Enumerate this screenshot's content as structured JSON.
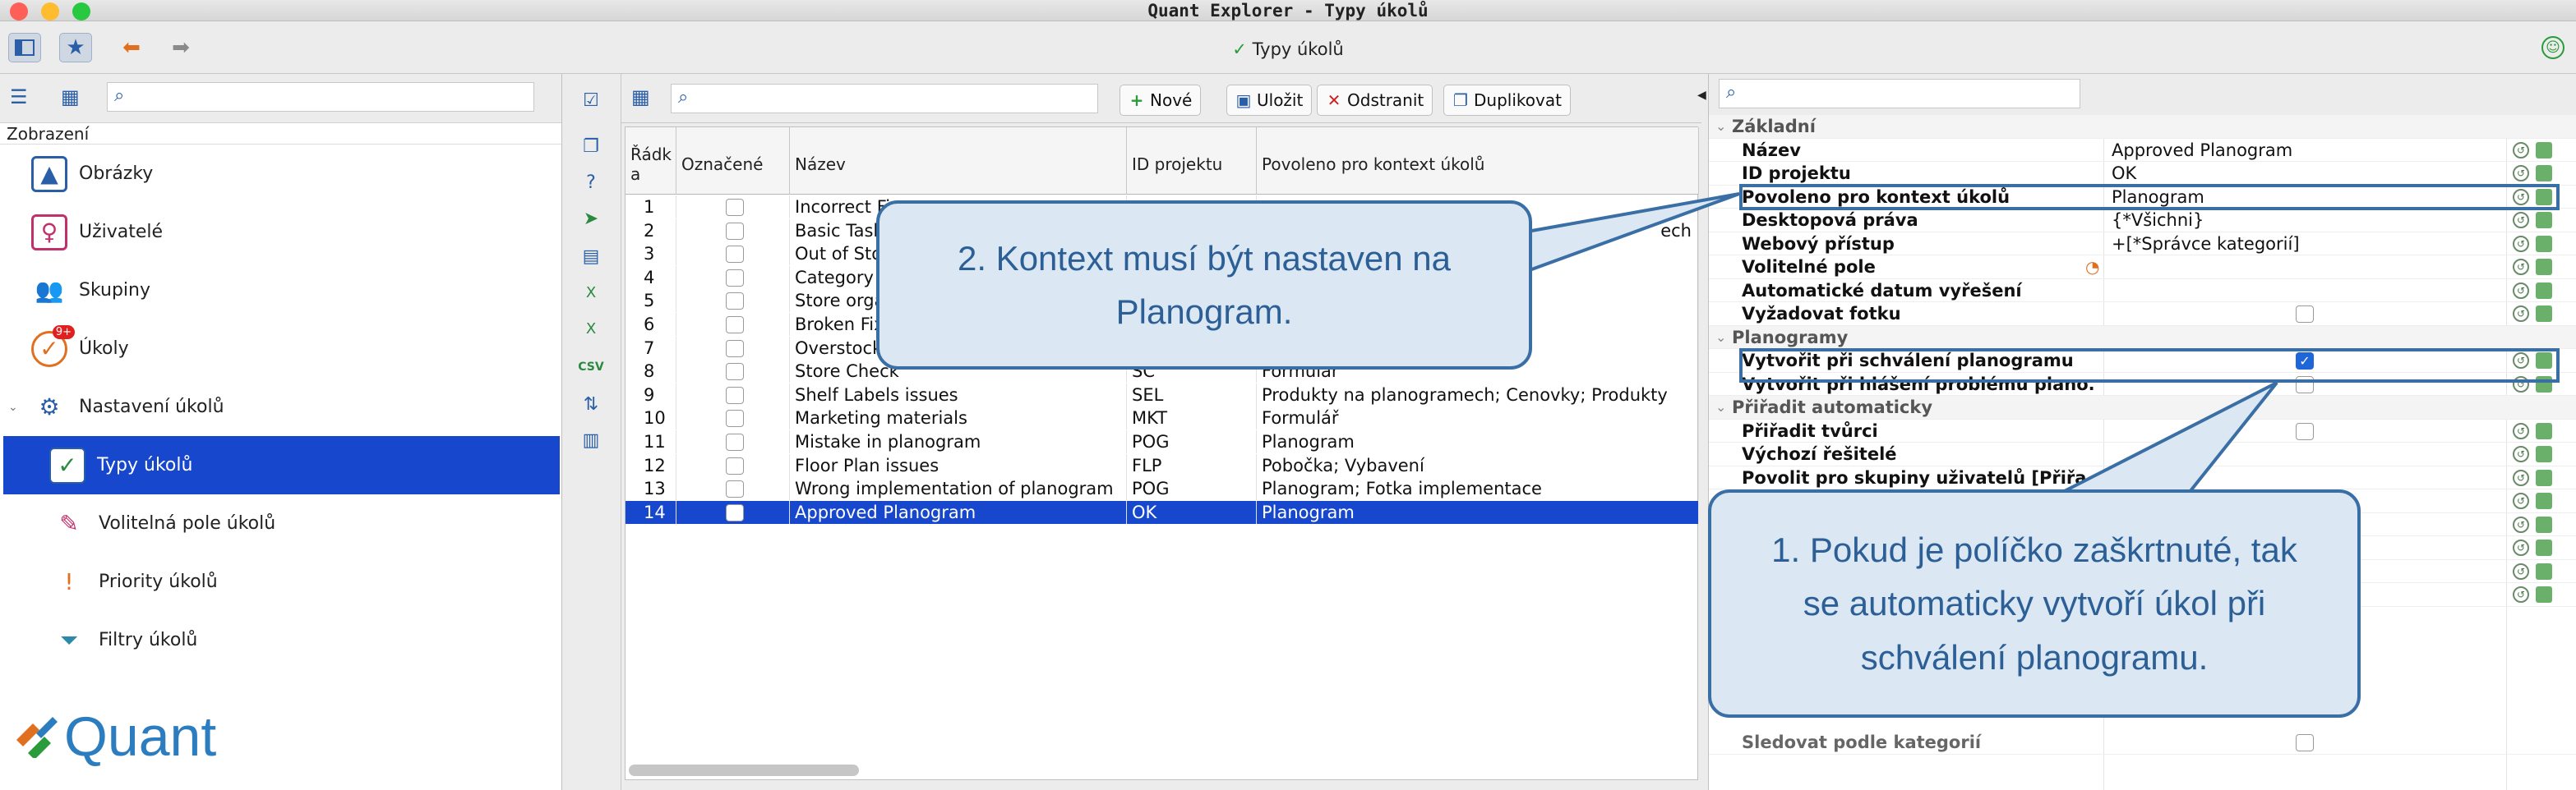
{
  "window": {
    "title": "Quant Explorer - Typy úkolů",
    "toolbar_title": "Typy úkolů"
  },
  "left": {
    "section": "Zobrazení",
    "items": [
      {
        "label": "Obrázky",
        "icon": "images-icon"
      },
      {
        "label": "Uživatelé",
        "icon": "user-icon"
      },
      {
        "label": "Skupiny",
        "icon": "groups-icon"
      },
      {
        "label": "Úkoly",
        "icon": "tasks-icon",
        "badge": "9+"
      },
      {
        "label": "Nastavení úkolů",
        "icon": "task-settings-icon"
      },
      {
        "label": "Typy úkolů",
        "icon": "task-types-icon"
      },
      {
        "label": "Volitelná pole úkolů",
        "icon": "optional-fields-icon"
      },
      {
        "label": "Priority úkolů",
        "icon": "priority-icon"
      },
      {
        "label": "Filtry úkolů",
        "icon": "filter-icon"
      }
    ],
    "logo": "Quant"
  },
  "toolbar": {
    "new": "Nové",
    "save": "Uložit",
    "delete": "Odstranit",
    "duplicate": "Duplikovat"
  },
  "grid": {
    "headers": [
      "Řádk a",
      "Označené",
      "Název",
      "ID projektu",
      "Povoleno pro kontext úkolů"
    ],
    "rows": [
      [
        "1",
        "Incorrect Fix",
        "",
        ""
      ],
      [
        "2",
        "Basic Tasl",
        "",
        "ech"
      ],
      [
        "3",
        "Out of Sto",
        "",
        ""
      ],
      [
        "4",
        "Category",
        "",
        ""
      ],
      [
        "5",
        "Store orga",
        "",
        ""
      ],
      [
        "6",
        "Broken Fix",
        "",
        ""
      ],
      [
        "7",
        "Overstock",
        "",
        ""
      ],
      [
        "8",
        "Store Check",
        "SC",
        "Formulář"
      ],
      [
        "9",
        "Shelf Labels issues",
        "SEL",
        "Produkty na planogramech; Cenovky; Produkty"
      ],
      [
        "10",
        "Marketing materials",
        "MKT",
        "Formulář"
      ],
      [
        "11",
        "Mistake in planogram",
        "POG",
        "Planogram"
      ],
      [
        "12",
        "Floor Plan issues",
        "FLP",
        "Pobočka; Vybavení"
      ],
      [
        "13",
        "Wrong implementation of planogram",
        "POG",
        "Planogram; Fotka implementace"
      ],
      [
        "14",
        "Approved Planogram",
        "OK",
        "Planogram"
      ]
    ]
  },
  "props": {
    "groups": {
      "basic": "Základní",
      "planogram": "Planogramy",
      "auto": "Přiřadit automaticky"
    },
    "basic": [
      {
        "key": "Název",
        "value": "Approved Planogram"
      },
      {
        "key": "ID projektu",
        "value": "OK"
      },
      {
        "key": "Povoleno pro kontext úkolů",
        "value": "Planogram"
      },
      {
        "key": "Desktopová práva",
        "value": "{*Všichni}"
      },
      {
        "key": "Webový přístup",
        "value": "+[*Správce kategorií]"
      },
      {
        "key": "Volitelné pole",
        "value": ""
      },
      {
        "key": "Automatické datum vyřešení",
        "value": ""
      },
      {
        "key": "Vyžadovat fotku",
        "value": ""
      }
    ],
    "planogram": [
      {
        "key": "Vytvořit při schválení planogramu",
        "value": ""
      },
      {
        "key": "Vytvořit při hlášení problému plano...",
        "value": ""
      }
    ],
    "auto": [
      {
        "key": "Přiřadit tvůrci",
        "value": ""
      },
      {
        "key": "Výchozí řešitelé",
        "value": ""
      },
      {
        "key": "Povolit pro skupiny uživatelů [Přiřa...",
        "value": ""
      }
    ],
    "bottom": [
      {
        "key": "Sledovat podle kategorií",
        "value": ""
      }
    ]
  },
  "callouts": {
    "context": "2. Kontext musí být nastaven na Planogram.",
    "checkbox": "1. Pokud je políčko zaškrtnuté, tak se automaticky vytvoří úkol při schválení planogramu."
  }
}
